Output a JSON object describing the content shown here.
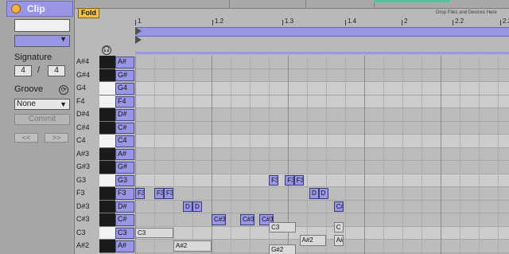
{
  "clip_panel": {
    "title": "Clip",
    "signature_label": "Signature",
    "signature_numerator": "4",
    "signature_separator": "/",
    "signature_denominator": "4",
    "groove_label": "Groove",
    "groove_value": "None",
    "commit_label": "Commit",
    "nudge_back": "<<",
    "nudge_forward": ">>"
  },
  "header": {
    "fold_label": "Fold",
    "drop_hint": "Drop Files and Devices Here"
  },
  "ruler": {
    "bars": [
      "1",
      "1.2",
      "1.3",
      "1.4",
      "2",
      "2.2",
      "2.3"
    ]
  },
  "note_names": [
    "A#4",
    "G#4",
    "G4",
    "F4",
    "D#4",
    "C#4",
    "C4",
    "A#3",
    "G#3",
    "G3",
    "F3",
    "D#3",
    "C#3",
    "C3",
    "A#2"
  ],
  "key_labels": [
    "A#",
    "G#",
    "G4",
    "F4",
    "D#",
    "C#",
    "C4",
    "A#",
    "G#",
    "G3",
    "F3",
    "D#",
    "C#",
    "C3",
    "A#"
  ],
  "key_colors": [
    "black",
    "black",
    "white",
    "white",
    "black",
    "black",
    "white",
    "black",
    "black",
    "white",
    "black",
    "black",
    "black",
    "white",
    "black"
  ],
  "notes": [
    {
      "label": "F3",
      "row": 10,
      "start": 0.0,
      "length": 0.12
    },
    {
      "label": "F3",
      "row": 10,
      "start": 0.25,
      "length": 0.125
    },
    {
      "label": "F3",
      "row": 10,
      "start": 0.375,
      "length": 0.125
    },
    {
      "label": "D",
      "row": 11,
      "start": 0.625,
      "length": 0.11
    },
    {
      "label": "D",
      "row": 11,
      "start": 0.75,
      "length": 0.11
    },
    {
      "label": "C#3",
      "row": 12,
      "start": 1.0,
      "length": 0.185
    },
    {
      "label": "C#3",
      "row": 12,
      "start": 1.375,
      "length": 0.185
    },
    {
      "label": "C#3",
      "row": 12,
      "start": 1.625,
      "length": 0.185
    },
    {
      "label": "F3",
      "row": 9,
      "start": 1.75,
      "length": 0.08
    },
    {
      "label": "F3",
      "row": 9,
      "start": 1.96,
      "length": 0.08
    },
    {
      "label": "F3",
      "row": 9,
      "start": 2.08,
      "length": 0.08
    },
    {
      "label": "D",
      "row": 10,
      "start": 2.28,
      "length": 0.08
    },
    {
      "label": "D",
      "row": 10,
      "start": 2.4,
      "length": 0.08
    },
    {
      "label": "C#3",
      "row": 11,
      "start": 2.6,
      "length": 0.08
    },
    {
      "label": "C3",
      "row": 13,
      "start": 0.0,
      "length": 0.5,
      "pale": true
    },
    {
      "label": "A#2",
      "row": 14,
      "start": 0.5,
      "length": 0.5,
      "pale": true
    },
    {
      "label": "G#2",
      "row": 15,
      "start": 1.0,
      "length": 0.5,
      "pale": true
    },
    {
      "label": "C3",
      "row": 12.6,
      "start": 1.75,
      "length": 0.35,
      "pale": true
    },
    {
      "label": "A#2",
      "row": 13.6,
      "start": 2.15,
      "length": 0.35,
      "pale": true
    },
    {
      "label": "G#2",
      "row": 14.3,
      "start": 1.75,
      "length": 0.35,
      "pale": true
    },
    {
      "label": "C",
      "row": 12.6,
      "start": 2.6,
      "length": 0.1,
      "pale": true
    },
    {
      "label": "A#",
      "row": 13.6,
      "start": 2.6,
      "length": 0.1,
      "pale": true
    }
  ],
  "colors": {
    "accent": "#9a96e6",
    "fold": "#f2c14c",
    "clip_dot": "#f5b23a",
    "strip_green": "#4fc6a1"
  }
}
